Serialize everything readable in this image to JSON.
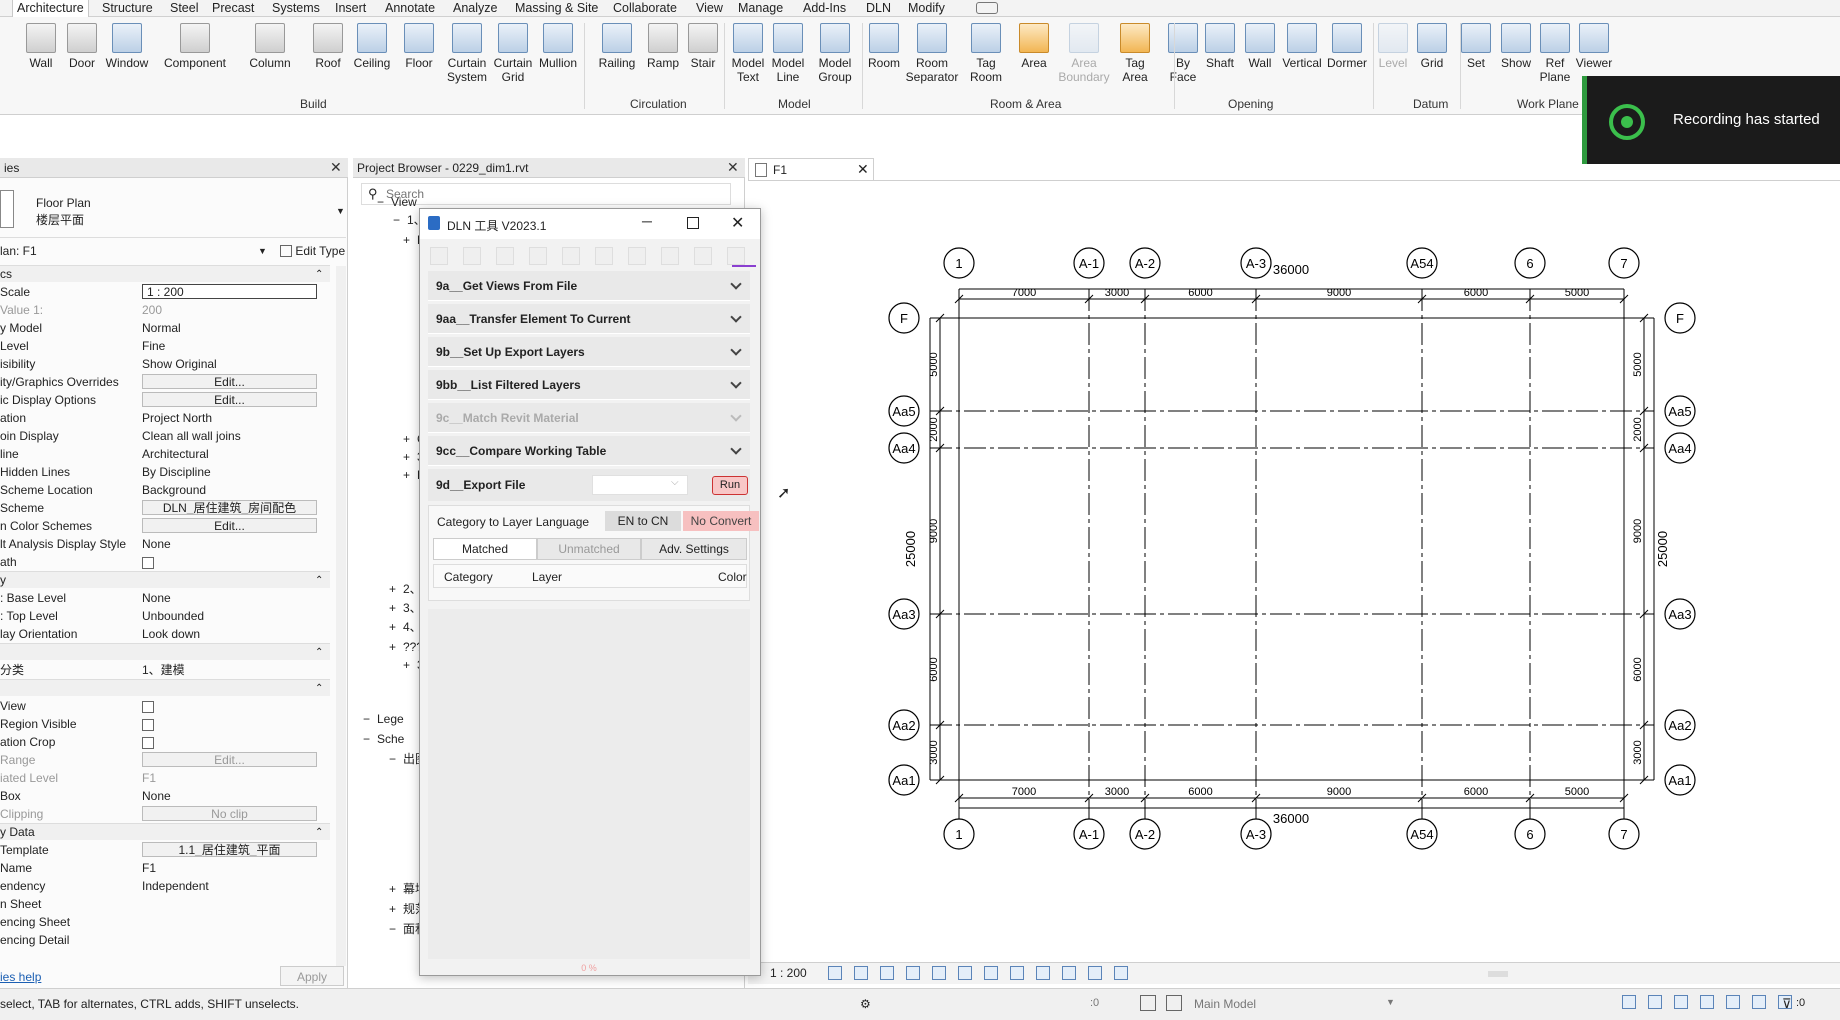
{
  "menu": {
    "tabs": [
      "Architecture",
      "Structure",
      "Steel",
      "Precast",
      "Systems",
      "Insert",
      "Annotate",
      "Analyze",
      "Massing & Site",
      "Collaborate",
      "View",
      "Manage",
      "Add-Ins",
      "DLN",
      "Modify"
    ],
    "active": "Architecture"
  },
  "ribbon": {
    "tools": [
      {
        "label": "Wall"
      },
      {
        "label": "Door"
      },
      {
        "label": "Window"
      },
      {
        "label": "Component"
      },
      {
        "label": "Column"
      },
      {
        "label": "Roof"
      },
      {
        "label": "Ceiling"
      },
      {
        "label": "Floor"
      },
      {
        "label": "Curtain\nSystem"
      },
      {
        "label": "Curtain\nGrid"
      },
      {
        "label": "Mullion"
      },
      {
        "label": "Railing"
      },
      {
        "label": "Ramp"
      },
      {
        "label": "Stair"
      },
      {
        "label": "Model\nText"
      },
      {
        "label": "Model\nLine"
      },
      {
        "label": "Model\nGroup"
      },
      {
        "label": "Room"
      },
      {
        "label": "Room\nSeparator"
      },
      {
        "label": "Tag\nRoom"
      },
      {
        "label": "Area"
      },
      {
        "label": "Area\nBoundary"
      },
      {
        "label": "Tag\nArea"
      },
      {
        "label": "By\nFace"
      },
      {
        "label": "Shaft"
      },
      {
        "label": "Wall"
      },
      {
        "label": "Vertical"
      },
      {
        "label": "Dormer"
      },
      {
        "label": "Level"
      },
      {
        "label": "Grid"
      },
      {
        "label": "Set"
      },
      {
        "label": "Show"
      },
      {
        "label": "Ref\nPlane"
      },
      {
        "label": "Viewer"
      }
    ],
    "groups": [
      "Build",
      "Circulation",
      "Model",
      "Room & Area",
      "Opening",
      "Datum",
      "Work Plane"
    ]
  },
  "toast": {
    "text": "Recording has started"
  },
  "properties": {
    "title": "ies",
    "type_name": "Floor Plan",
    "type_name_cn": "楼层平面",
    "selector": "lan: F1",
    "edit_type": "Edit Type",
    "rows": [
      {
        "k": "cs",
        "v": "",
        "section": true
      },
      {
        "k": "Scale",
        "v": "1 : 200",
        "box": true
      },
      {
        "k": "Value   1:",
        "v": "200",
        "gray": true
      },
      {
        "k": "y Model",
        "v": "Normal"
      },
      {
        "k": "Level",
        "v": "Fine"
      },
      {
        "k": "isibility",
        "v": "Show Original"
      },
      {
        "k": "ity/Graphics Overrides",
        "v": "Edit...",
        "box": true
      },
      {
        "k": "ic Display Options",
        "v": "Edit...",
        "box": true
      },
      {
        "k": "ation",
        "v": "Project North"
      },
      {
        "k": "oin Display",
        "v": "Clean all wall joins"
      },
      {
        "k": "line",
        "v": "Architectural"
      },
      {
        "k": "Hidden Lines",
        "v": "By Discipline"
      },
      {
        "k": "Scheme Location",
        "v": "Background"
      },
      {
        "k": "Scheme",
        "v": "DLN_居住建筑_房间配色",
        "box": true
      },
      {
        "k": "n Color Schemes",
        "v": "Edit...",
        "box": true
      },
      {
        "k": "lt Analysis Display Style",
        "v": "None"
      },
      {
        "k": "ath",
        "v": "",
        "cb": true
      },
      {
        "k": "y",
        "v": "",
        "section": true
      },
      {
        "k": ": Base Level",
        "v": "None"
      },
      {
        "k": ": Top Level",
        "v": "Unbounded"
      },
      {
        "k": "lay Orientation",
        "v": "Look down"
      },
      {
        "k": "",
        "v": "",
        "section": true
      },
      {
        "k": "分类",
        "v": "1、建模"
      },
      {
        "k": "",
        "v": "",
        "section": true
      },
      {
        "k": "View",
        "v": "",
        "cb": true
      },
      {
        "k": "Region Visible",
        "v": "",
        "cb": true
      },
      {
        "k": "ation Crop",
        "v": "",
        "cb": true
      },
      {
        "k": "Range",
        "v": "Edit...",
        "box": true,
        "gray": true
      },
      {
        "k": "iated Level",
        "v": "F1",
        "gray": true
      },
      {
        "k": "Box",
        "v": "None"
      },
      {
        "k": "Clipping",
        "v": "No clip",
        "box": true,
        "gray": true
      },
      {
        "k": "y Data",
        "v": "",
        "section": true
      },
      {
        "k": "Template",
        "v": "1.1_居住建筑_平面",
        "box": true
      },
      {
        "k": "Name",
        "v": "F1"
      },
      {
        "k": "endency",
        "v": "Independent"
      },
      {
        "k": "n Sheet",
        "v": ""
      },
      {
        "k": "encing Sheet",
        "v": ""
      },
      {
        "k": "encing Detail",
        "v": ""
      }
    ],
    "help": "ies help",
    "apply": "Apply"
  },
  "browser": {
    "title": "Project Browser - 0229_dim1.rvt",
    "search_placeholder": "Search",
    "items": [
      "View",
      "1、",
      "Fl",
      "Ce",
      "3D",
      "El",
      "2、出",
      "3、",
      "4、",
      "???",
      "3D",
      "Lege",
      "Sche",
      "出图",
      "幕墙",
      "规范",
      "面积"
    ]
  },
  "view": {
    "tab": "F1",
    "scale": "1 : 200",
    "model": "Main Model"
  },
  "dialog": {
    "title": "DLN 工具 V2023.1",
    "sections": [
      {
        "label": "9a__Get Views From File",
        "disabled": false
      },
      {
        "label": "9aa__Transfer Element To Current",
        "disabled": false
      },
      {
        "label": "9b__Set Up Export Layers",
        "disabled": false
      },
      {
        "label": "9bb__List Filtered Layers",
        "disabled": false
      },
      {
        "label": "9c__Match Revit Material",
        "disabled": true
      },
      {
        "label": "9cc__Compare Working Table",
        "disabled": false
      }
    ],
    "export": {
      "label": "9d__Export File",
      "run": "Run"
    },
    "lang_label": "Category to Layer Language",
    "lang_en_cn": "EN to CN",
    "lang_no_convert": "No Convert",
    "tabs": [
      "Matched",
      "Unmatched",
      "Adv. Settings"
    ],
    "columns": [
      "Category",
      "Layer",
      "Color"
    ],
    "progress": "0 %"
  },
  "status": {
    "text": "select, TAB for alternates, CTRL adds, SHIFT unselects.",
    "coords": ":0",
    "filter": ":0"
  },
  "plan": {
    "top_grids": [
      "1",
      "A-1",
      "A-2",
      "A-3",
      "A54",
      "6",
      "7"
    ],
    "side_grids": [
      "F",
      "Aa5",
      "Aa4",
      "Aa3",
      "Aa2",
      "Aa1"
    ],
    "spans": [
      "7000",
      "3000",
      "6000",
      "9000",
      "6000",
      "5000"
    ],
    "total_x": "36000",
    "vspans": [
      "5000",
      "2000",
      "9000",
      "6000",
      "3000"
    ],
    "total_y": "25000"
  }
}
